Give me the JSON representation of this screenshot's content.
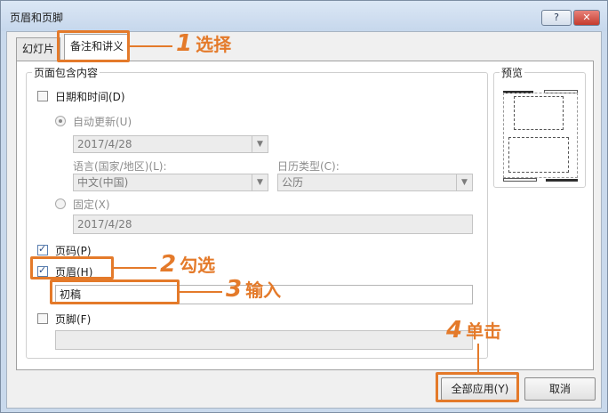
{
  "window": {
    "title": "页眉和页脚",
    "help": "?",
    "close": "✕"
  },
  "tabs": [
    {
      "label": "幻灯片"
    },
    {
      "label": "备注和讲义"
    }
  ],
  "group_main": {
    "label": "页面包含内容",
    "date_time": {
      "label": "日期和时间(D)",
      "checked": false
    },
    "auto_update": {
      "label": "自动更新(U)",
      "value": "2017/4/28"
    },
    "language": {
      "label": "语言(国家/地区)(L):",
      "value": "中文(中国)"
    },
    "calendar": {
      "label": "日历类型(C):",
      "value": "公历"
    },
    "fixed": {
      "label": "固定(X)",
      "value": "2017/4/28"
    },
    "page_number": {
      "label": "页码(P)",
      "checked": true
    },
    "header": {
      "label": "页眉(H)",
      "checked": true,
      "value": "初稿"
    },
    "footer": {
      "label": "页脚(F)",
      "checked": false,
      "value": ""
    }
  },
  "preview": {
    "label": "预览"
  },
  "buttons": {
    "apply_all": "全部应用(Y)",
    "cancel": "取消"
  },
  "callouts": [
    {
      "num": "1",
      "text": "选择"
    },
    {
      "num": "2",
      "text": "勾选"
    },
    {
      "num": "3",
      "text": "输入"
    },
    {
      "num": "4",
      "text": "单击"
    }
  ],
  "colors": {
    "accent": "#e47a2a",
    "title_bar": "#c9d9ec",
    "close": "#c43b2e"
  }
}
